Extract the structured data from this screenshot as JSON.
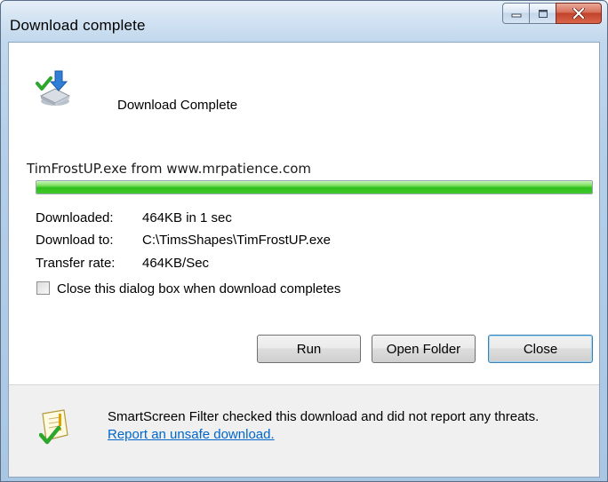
{
  "window": {
    "title": "Download complete"
  },
  "header": {
    "status_text": "Download Complete"
  },
  "download": {
    "file_line": "TimFrostUP.exe from www.mrpatience.com",
    "progress": 1.0,
    "rows": [
      {
        "label": "Downloaded:",
        "value": "464KB in 1 sec"
      },
      {
        "label": "Download to:",
        "value": "C:\\TimsShapes\\TimFrostUP.exe"
      },
      {
        "label": "Transfer rate:",
        "value": "464KB/Sec"
      }
    ]
  },
  "options": {
    "close_when_done_label": "Close this dialog box when download completes",
    "close_when_done_checked": false
  },
  "buttons": {
    "run": "Run",
    "open_folder": "Open Folder",
    "close": "Close"
  },
  "footer": {
    "message": "SmartScreen Filter checked this download and did not report any threats.",
    "link": "Report an unsafe download."
  },
  "colors": {
    "progress_green": "#2fbf1d",
    "link_blue": "#0066cc",
    "close_button_red": "#c2422a"
  },
  "icons": {
    "header": "download-complete-icon",
    "footer": "smartscreen-check-icon"
  }
}
